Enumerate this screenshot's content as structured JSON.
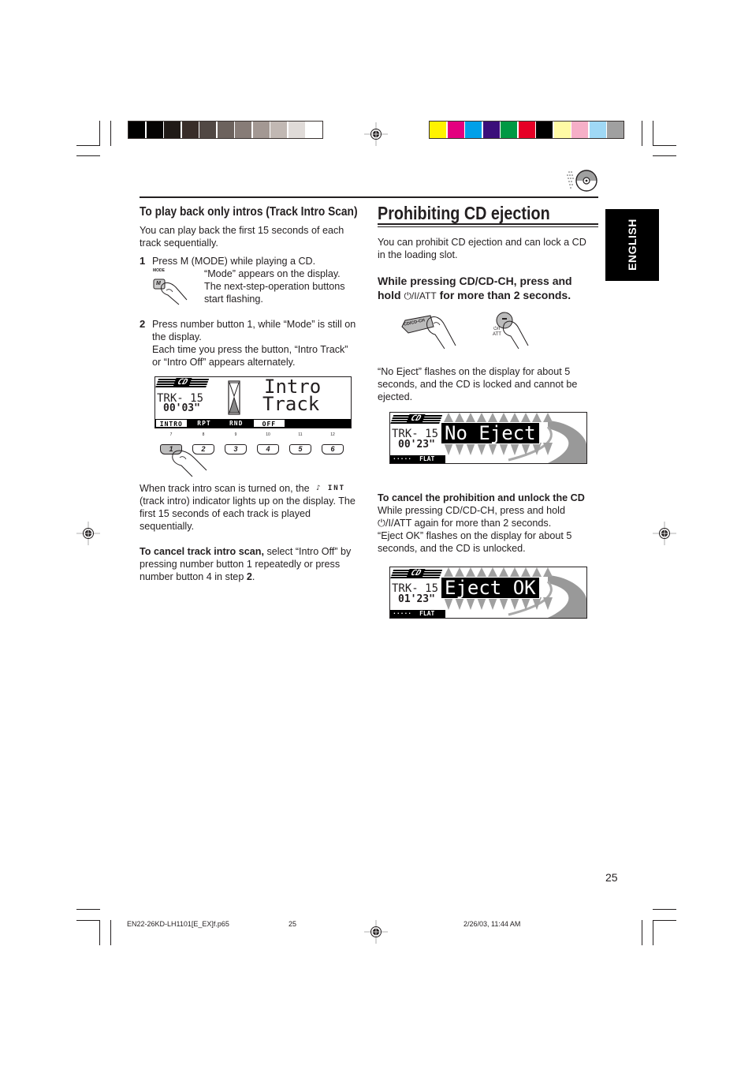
{
  "print_marks": {
    "gray_swatches": [
      "#000000",
      "#050303",
      "#201a17",
      "#382d29",
      "#514844",
      "#6c625d",
      "#877c77",
      "#a39893",
      "#c1b8b3",
      "#e0dbd8",
      "#ffffff"
    ],
    "color_swatches": [
      "#fff200",
      "#e4007f",
      "#00a0e9",
      "#3b0f7a",
      "#009944",
      "#e60026",
      "#000000",
      "#fffaa5",
      "#f6afc7",
      "#9fd8f5",
      "#a0a0a0"
    ]
  },
  "language_tab": "ENGLISH",
  "page_number": "25",
  "left": {
    "heading": "To play back only intros (Track Intro Scan)",
    "intro": "You can play back the first 15 seconds of each track sequentially.",
    "step1": {
      "num": "1",
      "text": "Press M (MODE) while playing a CD.",
      "mode_label": "MODE",
      "button_glyph": "M",
      "detail": "“Mode” appears on the display. The next-step-operation buttons start flashing."
    },
    "step2": {
      "num": "2",
      "text": "Press number button 1, while “Mode” is still on the display.",
      "detail": "Each time you press the button, “Intro Track” or “Intro Off” appears alternately."
    },
    "display": {
      "source": "CD",
      "track": "TRK- 15",
      "time": "00'03\"",
      "message_line1": "Intro",
      "message_line2": "Track",
      "func_labels": [
        "INTRO",
        "RPT",
        "RND",
        "OFF",
        "",
        ""
      ]
    },
    "preset_buttons": [
      {
        "label": "1",
        "fn": "7"
      },
      {
        "label": "2",
        "fn": "8"
      },
      {
        "label": "3",
        "fn": "9"
      },
      {
        "label": "4",
        "fn": "10"
      },
      {
        "label": "5",
        "fn": "11"
      },
      {
        "label": "6",
        "fn": "12"
      }
    ],
    "indicator_para_a": "When track intro scan is turned on, the",
    "indicator_glyph": "♪ INT",
    "indicator_para_b": "(track intro) indicator lights up on the display. The first 15 seconds of each track is played sequentially.",
    "cancel_bold": "To cancel track intro scan,",
    "cancel_text_a": " select “Intro Off” by pressing number button 1 repeatedly or press number button 4 in step ",
    "cancel_step": "2",
    "cancel_text_b": "."
  },
  "right": {
    "heading": "Prohibiting CD ejection",
    "intro": "You can prohibit CD ejection and can lock a CD in the loading slot.",
    "instruction_a": "While pressing CD/CD-CH, press and hold",
    "instruction_glyph": "⏻/I/ATT",
    "instruction_b": "for more than 2 seconds.",
    "cdch_button_label": "CD/CD-CH",
    "att_button_label_1": "⏻/I",
    "att_button_label_2": "ATT",
    "no_eject_text": "“No Eject” flashes on the display for about 5 seconds, and the CD is locked and cannot be ejected.",
    "display_no_eject": {
      "source": "CD",
      "track": "TRK- 15",
      "time": "00'23\"",
      "message": "No Eject",
      "bottom": "FLAT"
    },
    "cancel_heading": "To cancel the prohibition and unlock the CD",
    "cancel_line1": "While pressing CD/CD-CH, press and hold",
    "cancel_glyph": "⏻/I/ATT",
    "cancel_line2": "again for more than 2 seconds.",
    "cancel_line3": "“Eject OK” flashes on the display for about 5 seconds, and the CD is unlocked.",
    "display_eject_ok": {
      "source": "CD",
      "track": "TRK- 15",
      "time": "01'23\"",
      "message": "Eject OK",
      "bottom": "FLAT"
    }
  },
  "footer": {
    "file": "EN22-26KD-LH1101[E_EX]f.p65",
    "page": "25",
    "datetime": "2/26/03, 11:44 AM"
  }
}
